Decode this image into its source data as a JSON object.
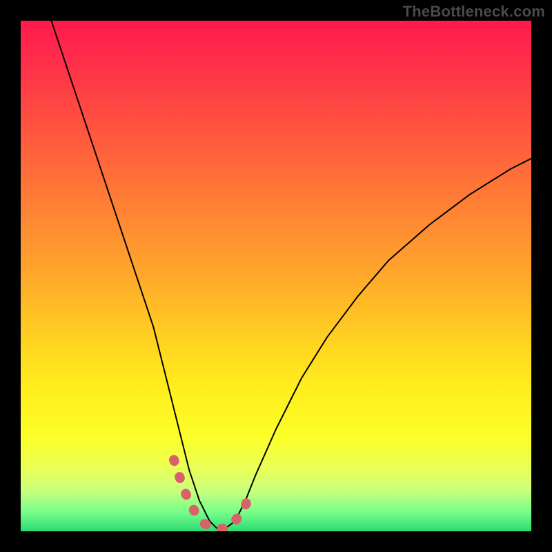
{
  "watermark": "TheBottleneck.com",
  "chart_data": {
    "type": "line",
    "title": "",
    "xlabel": "",
    "ylabel": "",
    "xlim": [
      0,
      100
    ],
    "ylim": [
      0,
      100
    ],
    "series": [
      {
        "name": "bottleneck-curve",
        "x": [
          6,
          10,
          14,
          18,
          22,
          26,
          29,
          31,
          33,
          35,
          37,
          38.5,
          40,
          42,
          44,
          46,
          50,
          55,
          60,
          66,
          72,
          80,
          88,
          96,
          100
        ],
        "values": [
          100,
          88,
          76,
          64,
          52,
          40,
          28,
          20,
          12,
          6,
          2,
          0.5,
          0.5,
          2,
          6,
          11,
          20,
          30,
          38,
          46,
          53,
          60,
          66,
          71,
          73
        ]
      }
    ],
    "highlight_segment": {
      "x": [
        30,
        32,
        34,
        36,
        38,
        40,
        42,
        44,
        45
      ],
      "values": [
        14,
        8,
        4,
        1.5,
        0.5,
        0.5,
        2,
        5,
        8
      ]
    },
    "gradient_stops": [
      {
        "pct": 0,
        "color": "#ff1a4d"
      },
      {
        "pct": 20,
        "color": "#ff5140"
      },
      {
        "pct": 48,
        "color": "#ffa22c"
      },
      {
        "pct": 72,
        "color": "#ffee1c"
      },
      {
        "pct": 92,
        "color": "#c9ff7a"
      },
      {
        "pct": 100,
        "color": "#2bdc74"
      }
    ]
  }
}
